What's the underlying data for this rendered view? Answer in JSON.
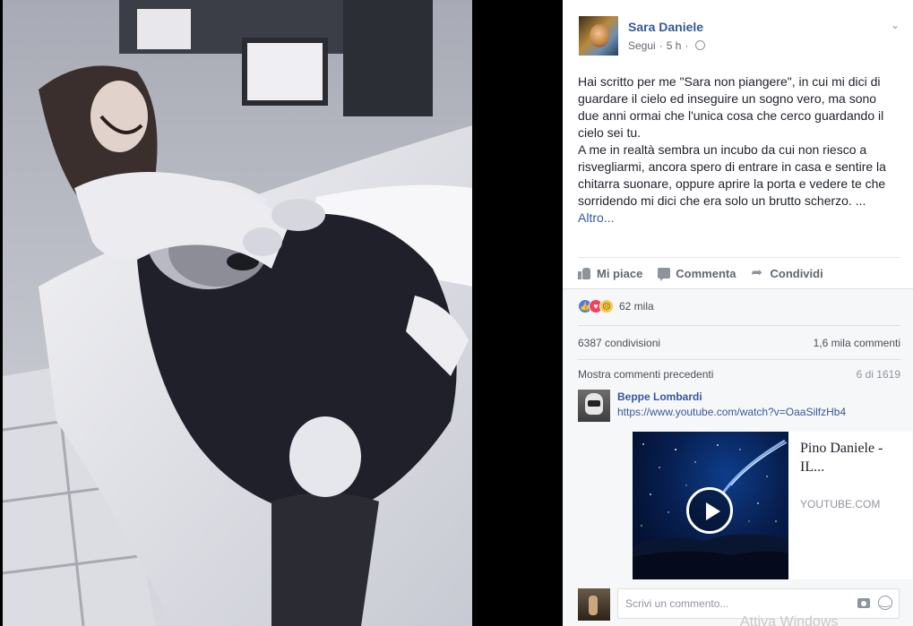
{
  "post": {
    "author": "Sara Daniele",
    "follow": "Segui",
    "time": "5 h",
    "text_paragraph_1": "Hai scritto per me \"Sara non piangere\", in cui mi dici di guardare il cielo ed inseguire un sogno vero, ma sono due anni ormai che l'unica cosa che cerco guardando il cielo sei tu.",
    "text_paragraph_2": "A me in realtà sembra un incubo da cui non riesco a risvegliarmi, ancora spero di entrare in casa e sentire la chitarra suonare, oppure aprire la porta e vedere te che sorridendo mi dici che era solo un brutto scherzo. ...",
    "more_link": "Altro..."
  },
  "actions": {
    "like": "Mi piace",
    "comment": "Commenta",
    "share": "Condividi"
  },
  "reactions": {
    "count": "62 mila",
    "types": [
      "like-icon",
      "love-icon",
      "sad-icon"
    ]
  },
  "stats": {
    "shares": "6387 condivisioni",
    "comments": "1,6 mila commenti"
  },
  "previous_comments": {
    "link": "Mostra commenti precedenti",
    "pager": "6 di 1619"
  },
  "comment": {
    "author": "Beppe Lombardi",
    "link": "https://www.youtube.com/watch?v=OaaSilfzHb4",
    "video": {
      "title": "Pino Daniele - IL...",
      "source": "YOUTUBE.COM"
    }
  },
  "composer": {
    "placeholder": "Scrivi un commento..."
  },
  "watermark": "Attiva Windows",
  "colors": {
    "link_blue": "#365899",
    "panel_gray": "#f6f7f9",
    "text": "#1d2129"
  }
}
